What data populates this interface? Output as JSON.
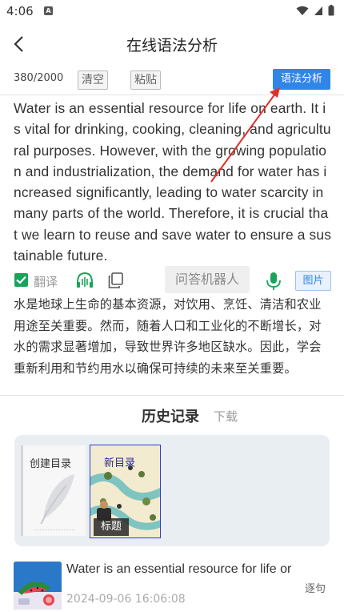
{
  "status": {
    "time": "4:06"
  },
  "header": {
    "title": "在线语法分析"
  },
  "toolbar": {
    "count": "380/2000",
    "clear_label": "清空",
    "paste_label": "粘贴",
    "analyze_label": "语法分析"
  },
  "input_text": "Water is an essential resource for life on earth. It is vital for drinking, cooking, cleaning, and agricultural purposes. However, with the growing population and industrialization, the demand for water has increased significantly, leading to water scarcity in many parts of the world. Therefore, it is crucial that we learn to reuse and save water to ensure a sustainable future.",
  "actions": {
    "translate_label": "翻译",
    "translate_checked": true,
    "ask_robot_label": "问答机器人",
    "image_label": "图片"
  },
  "translation": "水是地球上生命的基本资源，对饮用、烹饪、清洁和农业用途至关重要。然而，随着人口和工业化的不断增长，对水的需求显著增加，导致世界许多地区缺水。因此，学会重新利用和节约用水以确保可持续的未来至关重要。",
  "history": {
    "title": "历史记录",
    "download_label": "下载",
    "cards": [
      {
        "label": "创建目录"
      },
      {
        "label": "新目录",
        "tag": "标题"
      }
    ],
    "records": [
      {
        "text": "Water is an essential resource for life or",
        "date": "2024-09-06 16:06:08",
        "mode": "逐句"
      }
    ]
  },
  "colors": {
    "accent": "#2f86e8",
    "check": "#1aa35a",
    "annotation_arrow": "#e0302a"
  }
}
